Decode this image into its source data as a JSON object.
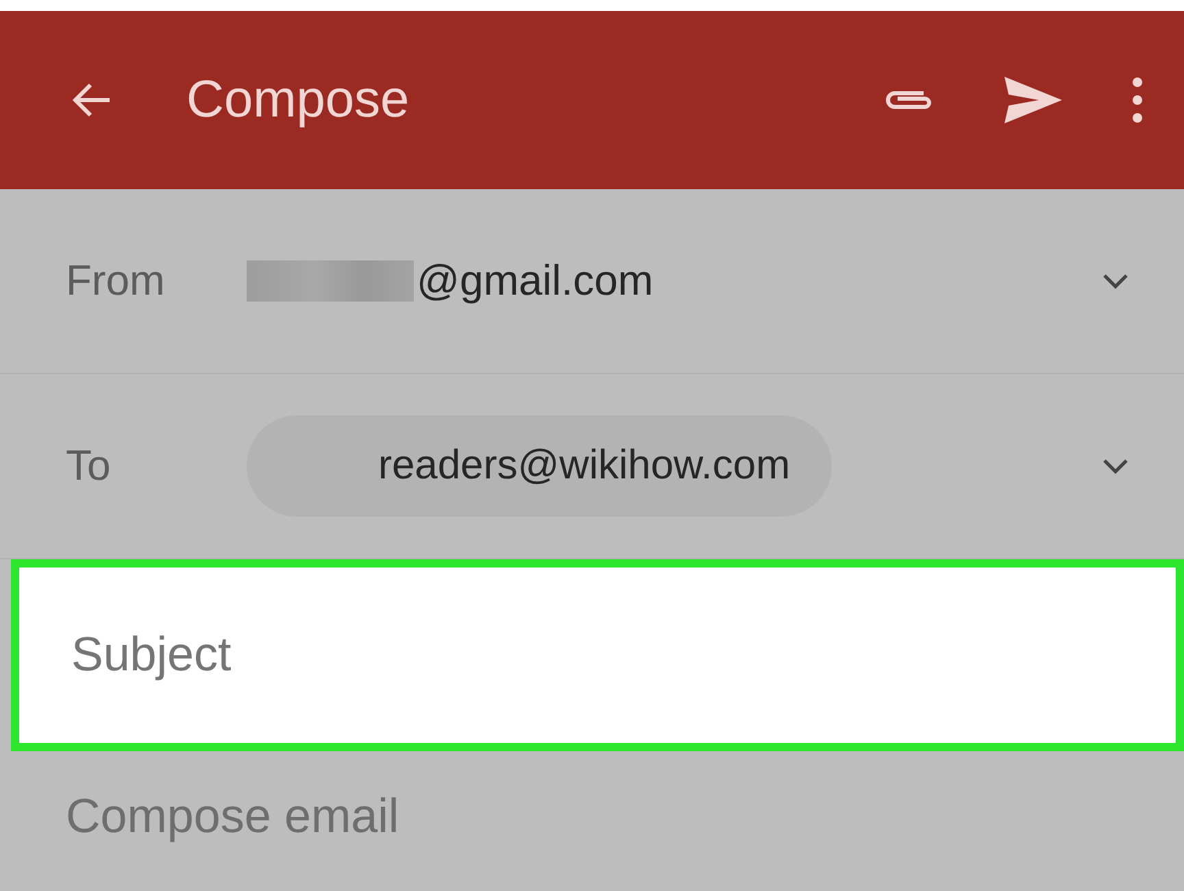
{
  "toolbar": {
    "title": "Compose"
  },
  "from": {
    "label": "From",
    "value": "@gmail.com",
    "redacted": true
  },
  "to": {
    "label": "To",
    "chip": "readers@wikihow.com"
  },
  "subject": {
    "placeholder": "Subject",
    "highlighted": true
  },
  "body": {
    "placeholder": "Compose email"
  }
}
